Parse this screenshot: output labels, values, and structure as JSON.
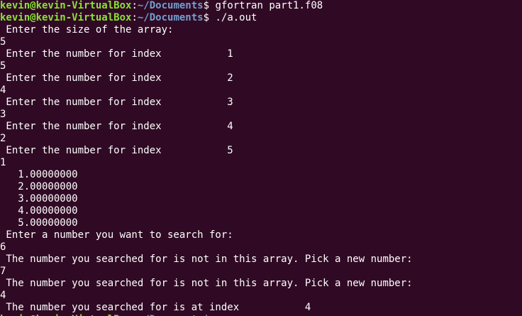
{
  "terminal": {
    "prompt": {
      "user_host": "kevin@kevin-VirtualBox",
      "separator": ":",
      "path": "~/Documents",
      "symbol": "$"
    },
    "lines": [
      {
        "kind": "prompt",
        "command": " gfortran part1.f08"
      },
      {
        "kind": "prompt",
        "command": " ./a.out"
      },
      {
        "kind": "output",
        "text": " Enter the size of the array:"
      },
      {
        "kind": "output",
        "text": "5"
      },
      {
        "kind": "output",
        "text": " Enter the number for index           1"
      },
      {
        "kind": "output",
        "text": "5"
      },
      {
        "kind": "output",
        "text": " Enter the number for index           2"
      },
      {
        "kind": "output",
        "text": "4"
      },
      {
        "kind": "output",
        "text": " Enter the number for index           3"
      },
      {
        "kind": "output",
        "text": "3"
      },
      {
        "kind": "output",
        "text": " Enter the number for index           4"
      },
      {
        "kind": "output",
        "text": "2"
      },
      {
        "kind": "output",
        "text": " Enter the number for index           5"
      },
      {
        "kind": "output",
        "text": "1"
      },
      {
        "kind": "output",
        "text": "   1.00000000    "
      },
      {
        "kind": "output",
        "text": "   2.00000000    "
      },
      {
        "kind": "output",
        "text": "   3.00000000    "
      },
      {
        "kind": "output",
        "text": "   4.00000000    "
      },
      {
        "kind": "output",
        "text": "   5.00000000    "
      },
      {
        "kind": "output",
        "text": " Enter a number you want to search for:"
      },
      {
        "kind": "output",
        "text": "6"
      },
      {
        "kind": "output",
        "text": " The number you searched for is not in this array. Pick a new number:"
      },
      {
        "kind": "output",
        "text": "7"
      },
      {
        "kind": "output",
        "text": " The number you searched for is not in this array. Pick a new number:"
      },
      {
        "kind": "output",
        "text": "4"
      },
      {
        "kind": "output",
        "text": " The number you searched for is at index           4"
      },
      {
        "kind": "prompt",
        "command": ""
      }
    ]
  },
  "colors": {
    "background": "#300a24",
    "user_host": "#8ae234",
    "path": "#729fcf",
    "text": "#ffffff"
  }
}
